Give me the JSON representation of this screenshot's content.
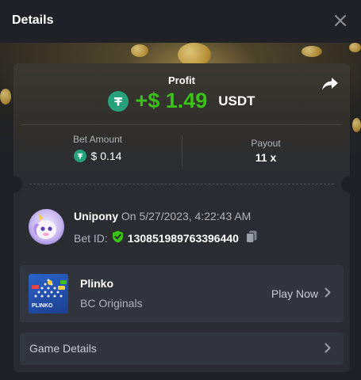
{
  "header": {
    "title": "Details"
  },
  "profit": {
    "label": "Profit",
    "value": "+$ 1.49",
    "currency": "USDT"
  },
  "bet_amount": {
    "label": "Bet Amount",
    "value": "$ 0.14"
  },
  "payout": {
    "label": "Payout",
    "value": "11 x"
  },
  "user": {
    "name": "Unipony",
    "date": "On 5/27/2023, 4:22:43 AM"
  },
  "bet": {
    "label": "Bet ID:",
    "id": "130851989763396440"
  },
  "game": {
    "name": "Plinko",
    "provider": "BC Originals",
    "play_label": "Play Now",
    "thumb_text": "PLINKO"
  },
  "game_details": {
    "label": "Game Details"
  },
  "colors": {
    "accent_green": "#3bc117",
    "usdt": "#26a17b",
    "background": "#1f2126",
    "card": "#2a2c32"
  },
  "icons": [
    "close-icon",
    "share-icon",
    "usdt-icon",
    "shield-check-icon",
    "copy-icon",
    "chevron-right-icon"
  ]
}
